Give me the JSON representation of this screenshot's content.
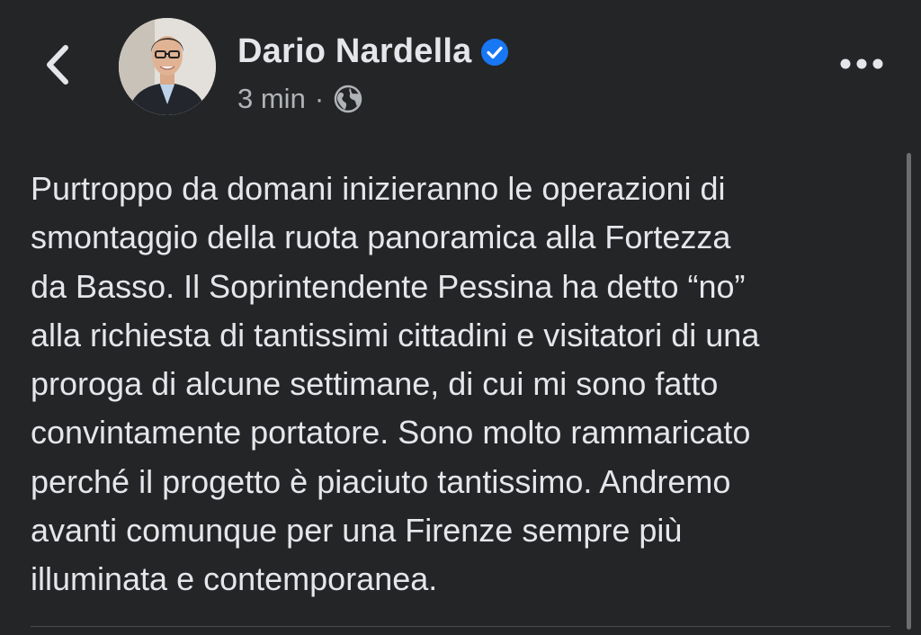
{
  "header": {
    "back_icon": "chevron-left-icon",
    "author_name": "Dario Nardella",
    "verified_icon": "verified-badge-icon",
    "timestamp": "3 min",
    "separator": "·",
    "privacy_icon": "globe-icon",
    "more_icon": "more-horizontal-icon"
  },
  "post": {
    "text": "Purtroppo da domani inizieranno le operazioni di\nsmontaggio della ruota panoramica alla Fortezza\nda Basso. Il Soprintendente Pessina ha detto “no”\nalla richiesta di tantissimi cittadini e visitatori di una\nproroga di alcune settimane, di cui mi sono fatto\nconvintamente portatore. Sono molto rammaricato\nperché il progetto è piaciuto tantissimo. Andremo\navanti comunque per una Firenze sempre più\nilluminata e contemporanea."
  },
  "colors": {
    "background": "#242526",
    "primary_text": "#e4e6eb",
    "secondary_text": "#b0b3b8",
    "verified_blue": "#1877f2"
  }
}
